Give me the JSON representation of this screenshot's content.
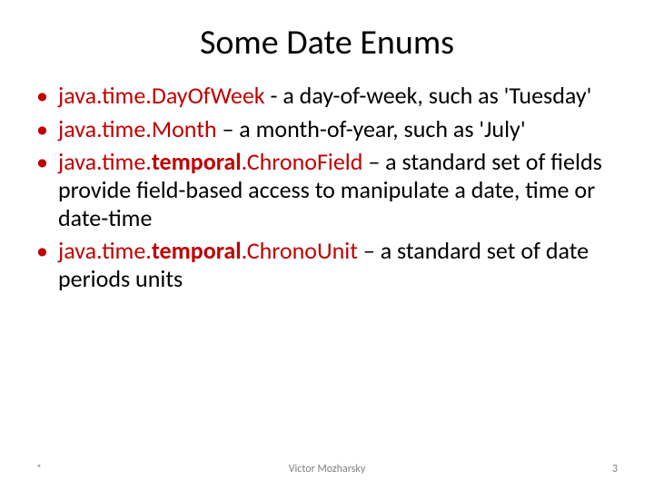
{
  "title": "Some Date Enums",
  "bullets": [
    {
      "class_prefix": "java.time",
      "dot1": ".",
      "class_bold": "",
      "dot2": "",
      "class_suffix": "DayOfWeek",
      "desc": " - a day-of-week, such as 'Tuesday'"
    },
    {
      "class_prefix": "java.time",
      "dot1": ".",
      "class_bold": "",
      "dot2": "",
      "class_suffix": "Month",
      "desc": " – a month-of-year, such as 'July'"
    },
    {
      "class_prefix": "java.time",
      "dot1": ".",
      "class_bold": "temporal",
      "dot2": ".",
      "class_suffix": "ChronoField",
      "desc": " – a standard set of fields provide field-based access to manipulate a date, time or date-time"
    },
    {
      "class_prefix": "java.time",
      "dot1": ".",
      "class_bold": "temporal",
      "dot2": ".",
      "class_suffix": "ChronoUnit",
      "desc": " – a standard set of date periods units"
    }
  ],
  "footer": {
    "star": "*",
    "author": "Victor Mozharsky",
    "page": "3"
  }
}
